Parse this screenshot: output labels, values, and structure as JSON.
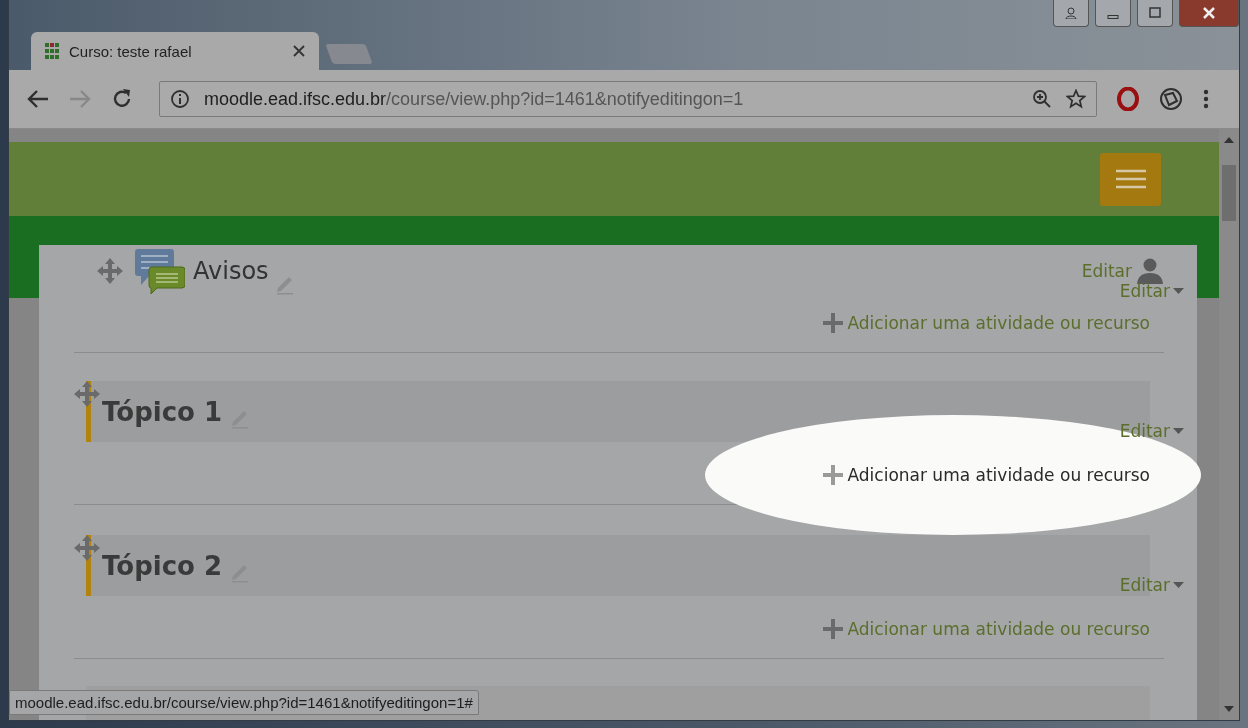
{
  "browser": {
    "tab": {
      "title": "Curso: teste rafael"
    },
    "address": {
      "domain": "moodle.ead.ifsc.edu.br",
      "path": "/course/view.php?id=1461&notifyeditingon=1"
    }
  },
  "sections": [
    {
      "kind": "activity",
      "activity_name": "Avisos",
      "activity_edit": "Editar",
      "section_edit": "Editar",
      "add_link": "Adicionar uma atividade ou recurso",
      "spotlight": false
    },
    {
      "kind": "topic",
      "title": "Tópico 1",
      "section_edit": "Editar",
      "add_link": "Adicionar uma atividade ou recurso",
      "spotlight": true
    },
    {
      "kind": "topic",
      "title": "Tópico 2",
      "section_edit": "Editar",
      "add_link": "Adicionar uma atividade ou recurso",
      "spotlight": false
    }
  ],
  "status_bar": {
    "url": "moodle.ead.ifsc.edu.br/course/view.php?id=1461&notifyeditingon=1#"
  }
}
